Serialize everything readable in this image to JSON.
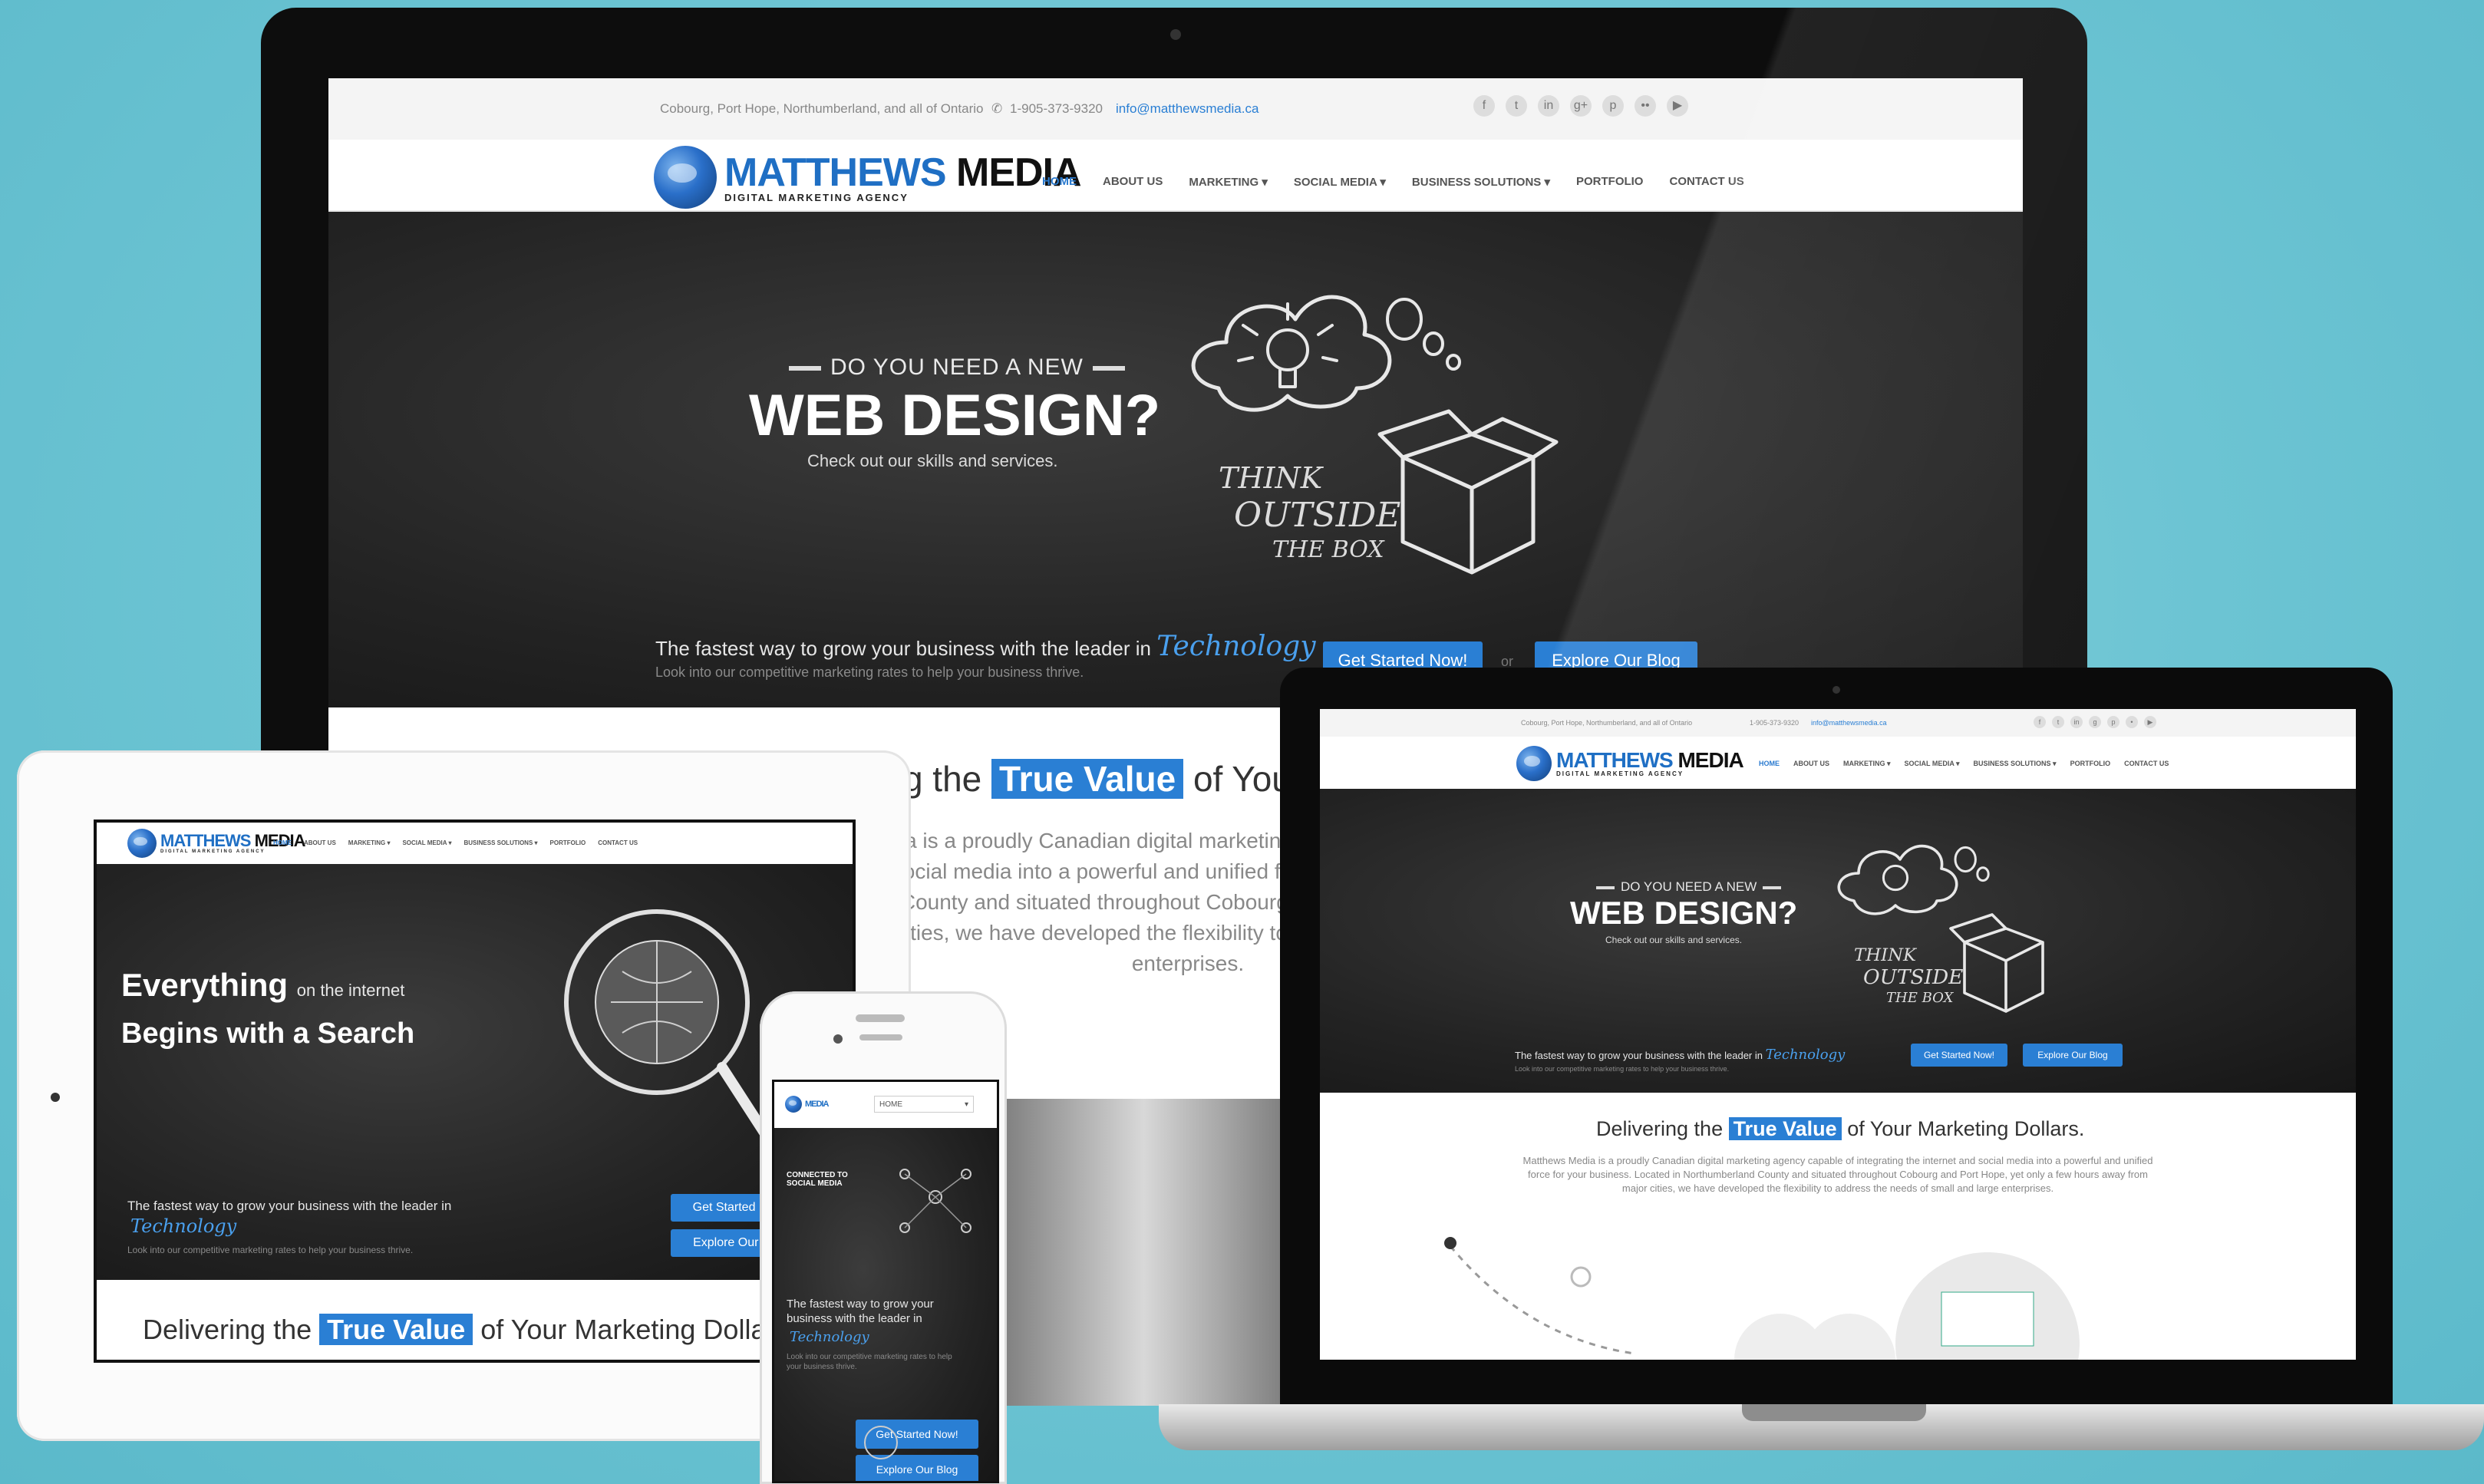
{
  "site": {
    "topbar": {
      "location": "Cobourg, Port Hope, Northumberland, and all of Ontario",
      "phone": "1-905-373-9320",
      "email": "info@matthewsmedia.ca"
    },
    "brand": {
      "name_first": "MATTHEWS",
      "name_second": "MEDIA",
      "tagline": "DIGITAL MARKETING AGENCY"
    },
    "nav": [
      "HOME",
      "ABOUT US",
      "MARKETING ▾",
      "SOCIAL MEDIA ▾",
      "BUSINESS SOLUTIONS ▾",
      "PORTFOLIO",
      "CONTACT US"
    ],
    "hero": {
      "kicker": "DO YOU NEED A NEW",
      "headline": "WEB DESIGN?",
      "subhead": "Check out our skills and services.",
      "chalk_think": "THINK",
      "chalk_outside": "OUTSIDE",
      "chalk_box": "THE BOX"
    },
    "cta": {
      "line": "The fastest way to grow your business with the leader in",
      "script_word": "Technology",
      "subline": "Look into our competitive marketing rates to help your business thrive.",
      "primary_button": "Get Started Now!",
      "secondary_button": "Explore Our Blog",
      "or": "or"
    },
    "value": {
      "before": "Delivering the",
      "highlight": "True Value",
      "after": "of Your Marketing Dollars.",
      "body": "Matthews Media is a proudly Canadian digital marketing agency capable of integrating the internet and social media into a powerful and unified force for your business. Located in Northumberland County and situated throughout Cobourg and Port Hope, yet only a few hours away from major cities, we have developed the flexibility to address the needs of small and large enterprises."
    },
    "tablet_hero": {
      "everything": "Everything",
      "on_internet": "on the internet",
      "begins": "Begins with a Search"
    },
    "phone": {
      "home_select": "HOME",
      "mini_headline": "CONNECTED TO SOCIAL MEDIA",
      "partial_value_after": "of Your Marketing Dolla"
    }
  },
  "icons": [
    "facebook-icon",
    "twitter-icon",
    "linkedin-icon",
    "google-plus-icon",
    "pinterest-icon",
    "flickr-icon",
    "youtube-icon"
  ],
  "colors": {
    "accent": "#2a7fd4",
    "background": "#6cc4d3",
    "hero": "#222222"
  }
}
